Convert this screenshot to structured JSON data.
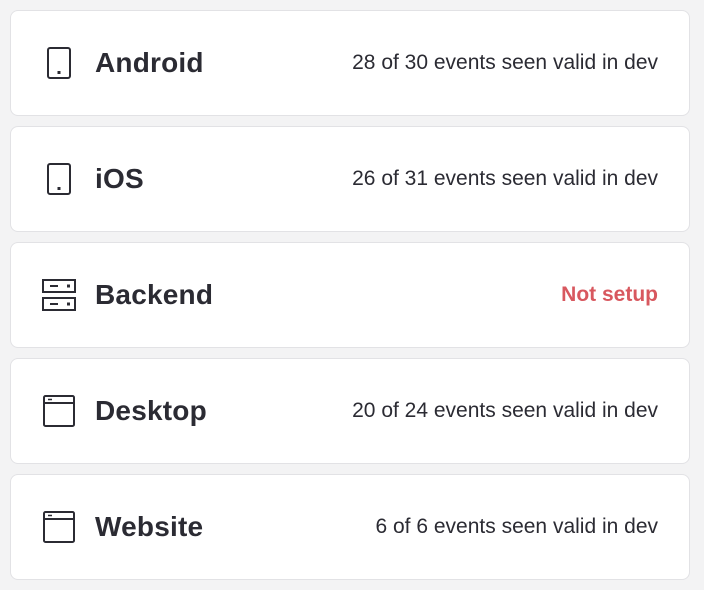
{
  "colors": {
    "text": "#2b2b33",
    "warning": "#d8585f",
    "card_border": "#e2e2e5"
  },
  "sources": [
    {
      "name": "Android",
      "icon": "mobile-icon",
      "status": "28 of 30 events seen valid in dev",
      "status_kind": "normal"
    },
    {
      "name": "iOS",
      "icon": "mobile-icon",
      "status": "26 of 31 events seen valid in dev",
      "status_kind": "normal"
    },
    {
      "name": "Backend",
      "icon": "server-icon",
      "status": "Not setup",
      "status_kind": "warning"
    },
    {
      "name": "Desktop",
      "icon": "window-icon",
      "status": "20 of 24 events seen valid in dev",
      "status_kind": "normal"
    },
    {
      "name": "Website",
      "icon": "window-icon",
      "status": "6 of 6 events seen valid in dev",
      "status_kind": "normal"
    }
  ]
}
